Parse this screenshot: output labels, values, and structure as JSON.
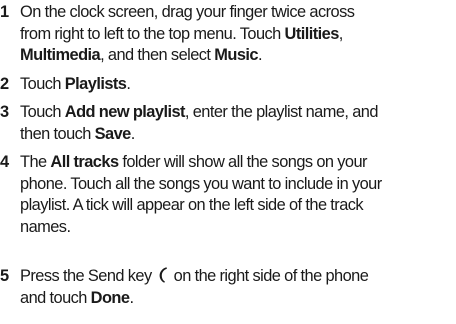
{
  "steps": [
    {
      "number": "1",
      "lines": [
        [
          "On the clock screen, drag your finger twice across"
        ],
        [
          "from right to left to the top menu. Touch ",
          "Utilities",
          ","
        ],
        [
          "Multimedia",
          ", and then select ",
          "Music",
          "."
        ]
      ]
    },
    {
      "number": "2",
      "lines": [
        [
          "Touch ",
          "Playlists",
          "."
        ]
      ]
    },
    {
      "number": "3",
      "lines": [
        [
          "Touch ",
          "Add new playlist",
          ", enter the playlist name, and"
        ],
        [
          "then touch ",
          "Save",
          "."
        ]
      ]
    },
    {
      "number": "4",
      "lines": [
        [
          "The ",
          "All tracks",
          " folder will show all the songs on your"
        ],
        [
          "phone. Touch all the songs you want to include in your"
        ],
        [
          "playlist. A tick will appear on the left side of the track"
        ],
        [
          "names."
        ]
      ]
    },
    {
      "number": "5",
      "lines": [
        [
          "Press the Send key",
          "on the right side of the phone"
        ],
        [
          "and touch ",
          "Done",
          "."
        ]
      ]
    }
  ],
  "icons": {
    "send_key": "send-key-icon",
    "color": "#1a1a1a"
  }
}
